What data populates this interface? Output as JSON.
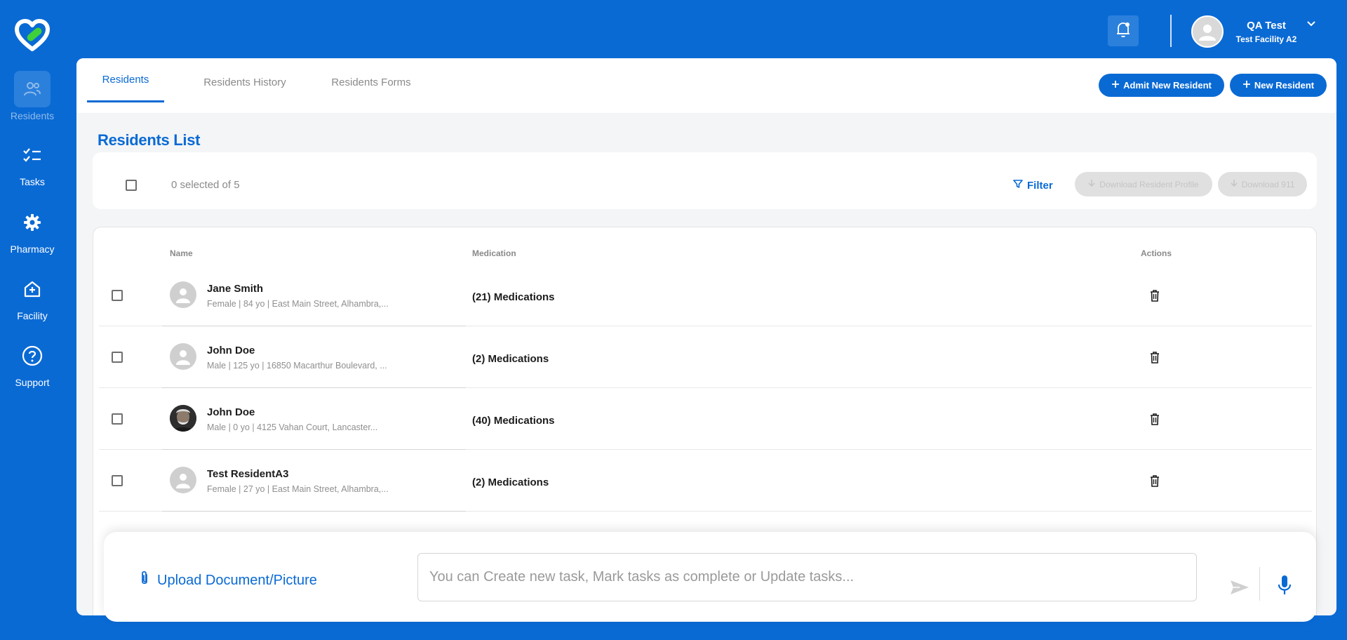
{
  "app": {
    "brand_color": "#0a6ad4",
    "logo_accent": "#3fd13a"
  },
  "sidebar": {
    "items": [
      {
        "label": "Residents",
        "icon": "residents-icon",
        "active": true
      },
      {
        "label": "Tasks",
        "icon": "tasks-checklist-icon",
        "active": false
      },
      {
        "label": "Pharmacy",
        "icon": "gear-icon",
        "active": false
      },
      {
        "label": "Facility",
        "icon": "facility-house-icon",
        "active": false
      },
      {
        "label": "Support",
        "icon": "question-icon",
        "active": false
      }
    ]
  },
  "header": {
    "user_name": "QA Test",
    "facility": "Test Facility A2"
  },
  "tabs": [
    {
      "label": "Residents",
      "active": true
    },
    {
      "label": "Residents History",
      "active": false
    },
    {
      "label": "Residents Forms",
      "active": false
    }
  ],
  "actions": {
    "admit_label": "Admit New Resident",
    "new_label": "New Resident"
  },
  "list": {
    "title": "Residents List",
    "selected_text": "0 selected of 5",
    "filter_label": "Filter",
    "download_profile_label": "Download Resident Profile",
    "download_911_label": "Download 911"
  },
  "table": {
    "columns": {
      "name": "Name",
      "medication": "Medication",
      "actions": "Actions"
    },
    "rows": [
      {
        "name": "Jane Smith",
        "details": "Female | 84 yo | East Main Street, Alhambra,...",
        "medications": "(21) Medications",
        "photo": false
      },
      {
        "name": "John Doe",
        "details": "Male | 125 yo | 16850 Macarthur Boulevard, ...",
        "medications": "(2) Medications",
        "photo": false
      },
      {
        "name": "John Doe",
        "details": "Male | 0 yo | 4125 Vahan Court, Lancaster...",
        "medications": "(40) Medications",
        "photo": true
      },
      {
        "name": "Test ResidentA3",
        "details": "Female | 27 yo | East Main Street, Alhambra,...",
        "medications": "(2) Medications",
        "photo": false
      }
    ]
  },
  "assistant": {
    "upload_label": "Upload Document/Picture",
    "placeholder": "You can Create new task, Mark tasks as complete or Update tasks..."
  }
}
